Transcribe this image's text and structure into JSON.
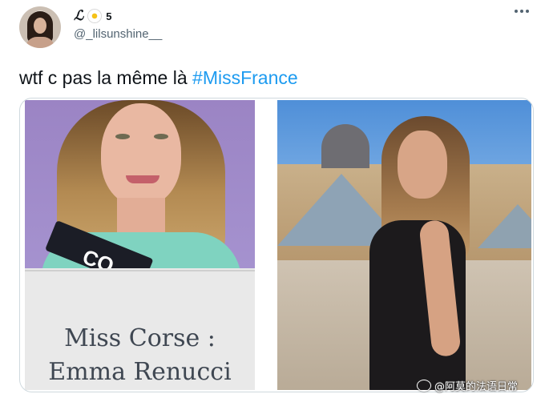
{
  "user": {
    "display_name_symbol": "ℒ",
    "display_name_count": "5",
    "handle": "@_lilsunshine__"
  },
  "tweet": {
    "text_prefix": "wtf c pas la même là ",
    "hashtag": "#MissFrance"
  },
  "media": {
    "left_caption_line1": "Miss Corse :",
    "left_caption_line2": "Emma Renucci",
    "left_sash_text": "CO"
  },
  "watermark": {
    "text": "@阿莫的法语日常"
  },
  "icons": {
    "flower": "daisy-emoji-icon",
    "more": "more-options-icon"
  }
}
